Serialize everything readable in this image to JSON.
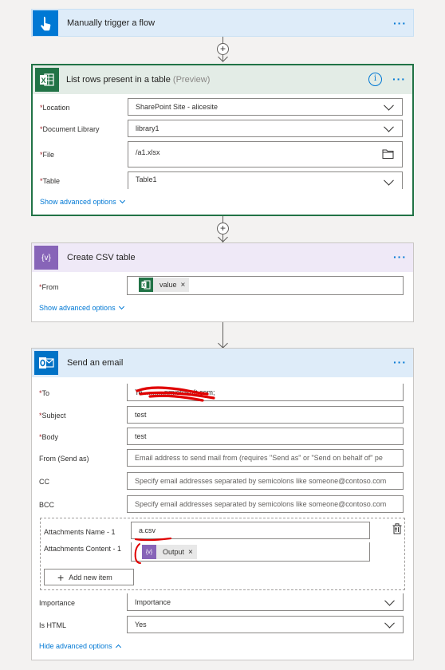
{
  "trigger": {
    "title": "Manually trigger a flow",
    "more_label": "···",
    "color": "#0078d4"
  },
  "list_rows": {
    "title": "List rows present in a table",
    "preview": "(Preview)",
    "info_label": "i",
    "more_label": "···",
    "fields": {
      "location": {
        "label": "Location",
        "value": "SharePoint Site - alicesite"
      },
      "document_library": {
        "label": "Document Library",
        "value": "library1"
      },
      "file": {
        "label": "File",
        "value": "/a1.xlsx"
      },
      "table": {
        "label": "Table",
        "value": "Table1"
      }
    },
    "advanced_link": "Show advanced options",
    "color": "#217346"
  },
  "csv": {
    "title": "Create CSV table",
    "more_label": "···",
    "icon_label": "{v}",
    "from_label": "From",
    "from_token": "value",
    "advanced_link": "Show advanced options",
    "color": "#8764b8"
  },
  "email": {
    "title": "Send an email",
    "more_label": "···",
    "to_label": "To",
    "to_value": "Te...........nmicrosoft.com;",
    "subject_label": "Subject",
    "subject_value": "test",
    "body_label": "Body",
    "body_value": "test",
    "from_label": "From (Send as)",
    "from_placeholder": "Email address to send mail from (requires \"Send as\" or \"Send on behalf of\" pe",
    "cc_label": "CC",
    "cc_placeholder": "Specify email addresses separated by semicolons like someone@contoso.com",
    "bcc_label": "BCC",
    "bcc_placeholder": "Specify email addresses separated by semicolons like someone@contoso.com",
    "attach_name_label": "Attachments Name - 1",
    "attach_name_value": "a.csv",
    "attach_content_label": "Attachments Content - 1",
    "attach_content_token": "Output",
    "add_item_label": "Add new item",
    "importance_label": "Importance",
    "importance_value": "Importance",
    "ishtml_label": "Is HTML",
    "ishtml_value": "Yes",
    "hide_link": "Hide advanced options",
    "color": "#0072c6"
  }
}
